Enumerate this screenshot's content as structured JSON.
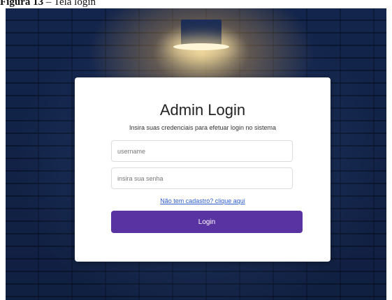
{
  "caption": {
    "label": "Figura 13",
    "separator": " – ",
    "text": "Tela login"
  },
  "login": {
    "title": "Admin Login",
    "subtitle": "Insira suas credenciais para efetuar login no sistema",
    "username_placeholder": "username",
    "password_placeholder": "insira sua senha",
    "register_link": "Não tem cadastro? clique aqui",
    "login_button": "Login"
  },
  "colors": {
    "button": "#5a33a3",
    "link": "#2c5ccf",
    "background_wall": "#13254c"
  }
}
